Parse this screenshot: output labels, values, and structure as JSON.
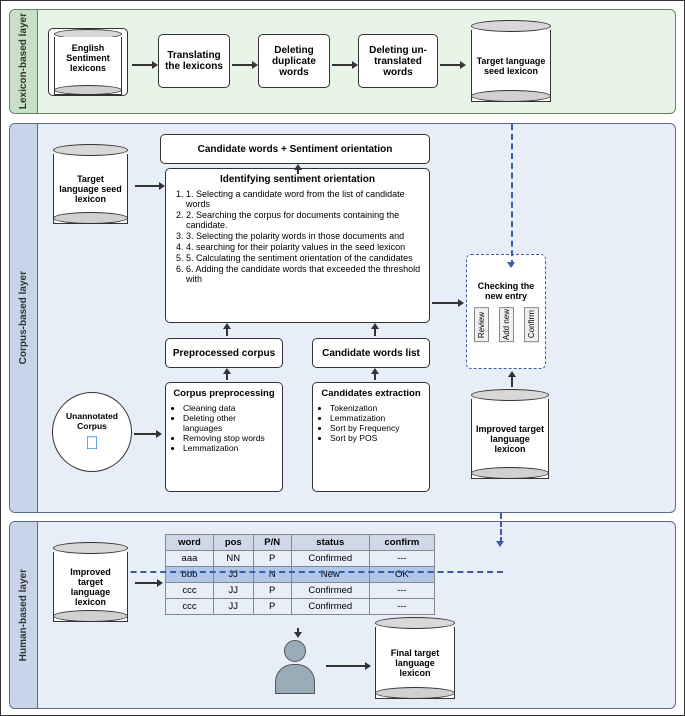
{
  "layers": {
    "lexicon": {
      "label": "Lexicon-based layer",
      "boxes": {
        "english_sentiments": "English Sentiment lexicons",
        "translating": "Translating the lexicons",
        "deleting_duplicate": "Deleting duplicate words",
        "deleting_untranslated": "Deleting un-translated words",
        "target_seed": "Target language seed lexicon"
      }
    },
    "corpus": {
      "label": "Corpus-based layer",
      "boxes": {
        "target_seed": "Target language seed lexicon",
        "candidate_sentiment": "Candidate words + Sentiment orientation",
        "preprocessed_corpus": "Preprocessed corpus",
        "candidate_words_list": "Candidate words list",
        "corpus_preprocessing": "Corpus preprocessing",
        "corpus_preprocessing_items": [
          "Cleaning data",
          "Deleting other languages",
          "Removing stop words",
          "Lemmatization"
        ],
        "candidates_extraction": "Candidates extraction",
        "candidates_extraction_items": [
          "Tokenization",
          "Lemmatization",
          "Sort by Frequency",
          "Sort by POS"
        ],
        "checking_new_entry": "Checking the new entry",
        "checking_labels": [
          "Review",
          "Add new",
          "Confirm"
        ],
        "improved_target": "Improved target language lexicon",
        "identifying_sentiment": "Identifying sentiment orientation",
        "identifying_steps": [
          "1. Selecting a candidate word from the list of candidate words",
          "2. Searching the corpus for documents containing the candidate.",
          "3. Selecting the polarity words in those documents and",
          "4. searching for their polarity values in the seed lexicon",
          "5. Calculating the sentiment orientation of the candidates",
          "6. Adding the candidate words that exceeded the threshold with"
        ],
        "unannotated_corpus": "Unannotated Corpus"
      }
    },
    "human": {
      "label": "Human-based layer",
      "table": {
        "headers": [
          "word",
          "pos",
          "P/N",
          "status",
          "confirm"
        ],
        "rows": [
          [
            "aaa",
            "NN",
            "P",
            "Confirmed",
            "---"
          ],
          [
            "bbb",
            "JJ",
            "N",
            "New",
            "OK"
          ],
          [
            "ccc",
            "JJ",
            "P",
            "Confirmed",
            "---"
          ],
          [
            "ccc",
            "JJ",
            "P",
            "Confirmed",
            "---"
          ]
        ]
      },
      "improved_lexicon": "Improved target language lexicon",
      "final_lexicon": "Final target language lexicon"
    }
  }
}
